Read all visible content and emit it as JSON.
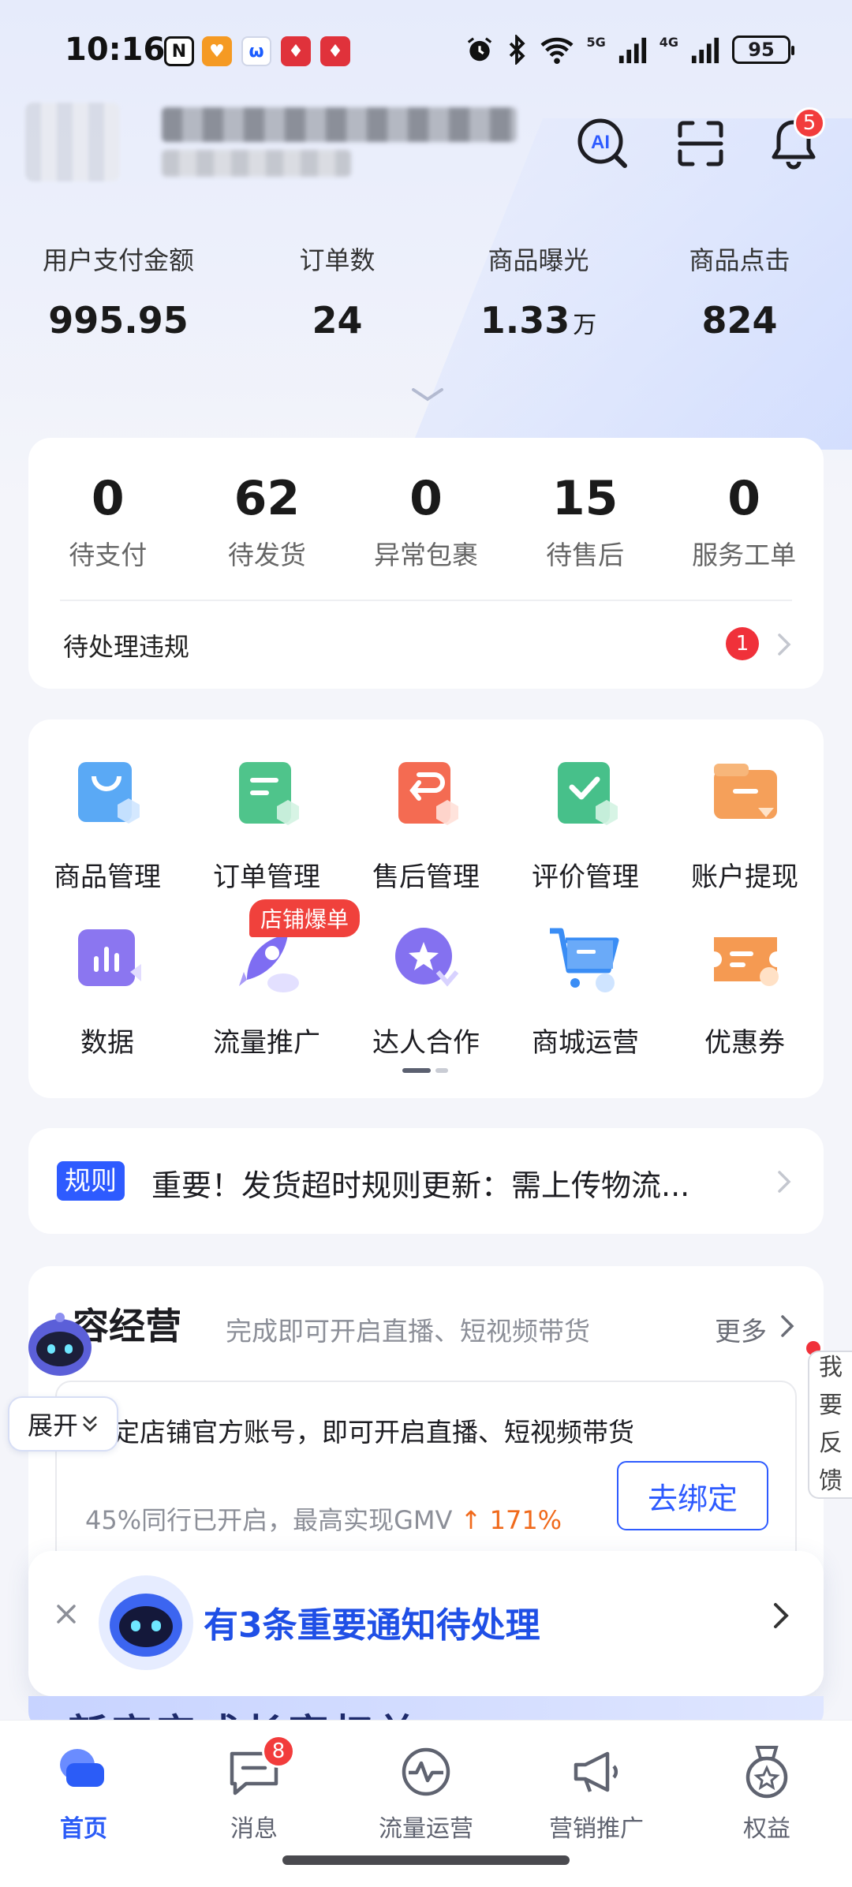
{
  "status_bar": {
    "time": "10:16",
    "battery": "95",
    "net1": "5G",
    "net2": "4G",
    "app_icons": [
      "nfc-icon",
      "taobao-icon",
      "app-icon",
      "xiaohongshu-icon",
      "xiaohongshu-icon"
    ]
  },
  "header": {
    "ai_icon_label": "AI",
    "notification_count": "5"
  },
  "stats": [
    {
      "label": "用户支付金额",
      "value": "995.95",
      "unit": ""
    },
    {
      "label": "订单数",
      "value": "24",
      "unit": ""
    },
    {
      "label": "商品曝光",
      "value": "1.33",
      "unit": "万"
    },
    {
      "label": "商品点击",
      "value": "824",
      "unit": ""
    }
  ],
  "orders": [
    {
      "count": "0",
      "label": "待支付"
    },
    {
      "count": "62",
      "label": "待发货"
    },
    {
      "count": "0",
      "label": "异常包裹"
    },
    {
      "count": "15",
      "label": "待售后"
    },
    {
      "count": "0",
      "label": "服务工单"
    }
  ],
  "violation": {
    "label": "待处理违规",
    "count": "1"
  },
  "tools": {
    "items": [
      {
        "label": "商品管理",
        "icon": "shopping-bag-icon"
      },
      {
        "label": "订单管理",
        "icon": "order-doc-icon"
      },
      {
        "label": "售后管理",
        "icon": "return-icon"
      },
      {
        "label": "评价管理",
        "icon": "review-check-icon"
      },
      {
        "label": "账户提现",
        "icon": "wallet-icon"
      },
      {
        "label": "数据",
        "icon": "chart-icon"
      },
      {
        "label": "流量推广",
        "icon": "rocket-icon"
      },
      {
        "label": "达人合作",
        "icon": "star-badge-icon"
      },
      {
        "label": "商城运营",
        "icon": "cart-icon"
      },
      {
        "label": "优惠券",
        "icon": "coupon-icon"
      }
    ],
    "promo_tag": "店铺爆单"
  },
  "rule": {
    "tag": "规则",
    "text": "重要！发货超时规则更新：需上传物流..."
  },
  "content": {
    "title": "容经营",
    "subtitle": "完成即可开启直播、短视频带货",
    "more": "更多",
    "bind_title": "定店铺官方账号，即可开启直播、短视频带货",
    "bind_meta": "45%同行已开启，最高实现GMV",
    "bind_growth": "171%",
    "bind_button": "去绑定"
  },
  "floating": {
    "expand": "展开",
    "feedback": "我要反馈"
  },
  "notice": {
    "text": "有3条重要通知待处理"
  },
  "promo_strip": {
    "text": "新商完成长亨权益"
  },
  "bottom_nav": [
    {
      "label": "首页",
      "icon": "home-icon",
      "active": true,
      "badge": ""
    },
    {
      "label": "消息",
      "icon": "message-icon",
      "active": false,
      "badge": "8"
    },
    {
      "label": "流量运营",
      "icon": "traffic-icon",
      "active": false,
      "badge": ""
    },
    {
      "label": "营销推广",
      "icon": "megaphone-icon",
      "active": false,
      "badge": ""
    },
    {
      "label": "权益",
      "icon": "medal-icon",
      "active": false,
      "badge": ""
    }
  ],
  "colors": {
    "brand_blue": "#2e5bff",
    "badge_red": "#f23c3c",
    "growth_orange": "#f06a1c"
  }
}
